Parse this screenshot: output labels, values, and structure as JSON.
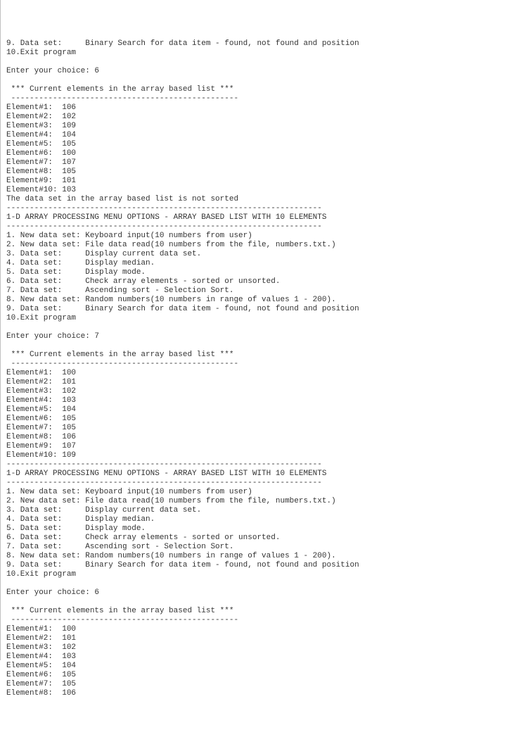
{
  "lines": [
    "9. Data set:     Binary Search for data item - found, not found and position",
    "10.Exit program",
    "",
    "Enter your choice: 6",
    "",
    " *** Current elements in the array based list ***",
    " -------------------------------------------------",
    "Element#1:  106",
    "Element#2:  102",
    "Element#3:  109",
    "Element#4:  104",
    "Element#5:  105",
    "Element#6:  100",
    "Element#7:  107",
    "Element#8:  105",
    "Element#9:  101",
    "Element#10: 103",
    "The data set in the array based list is not sorted",
    "--------------------------------------------------------------------",
    "1-D ARRAY PROCESSING MENU OPTIONS - ARRAY BASED LIST WITH 10 ELEMENTS",
    "--------------------------------------------------------------------",
    "1. New data set: Keyboard input(10 numbers from user)",
    "2. New data set: File data read(10 numbers from the file, numbers.txt.)",
    "3. Data set:     Display current data set.",
    "4. Data set:     Display median.",
    "5. Data set:     Display mode.",
    "6. Data set:     Check array elements - sorted or unsorted.",
    "7. Data set:     Ascending sort - Selection Sort.",
    "8. New data set: Random numbers(10 numbers in range of values 1 - 200).",
    "9. Data set:     Binary Search for data item - found, not found and position",
    "10.Exit program",
    "",
    "Enter your choice: 7",
    "",
    " *** Current elements in the array based list ***",
    " -------------------------------------------------",
    "Element#1:  100",
    "Element#2:  101",
    "Element#3:  102",
    "Element#4:  103",
    "Element#5:  104",
    "Element#6:  105",
    "Element#7:  105",
    "Element#8:  106",
    "Element#9:  107",
    "Element#10: 109",
    "--------------------------------------------------------------------",
    "1-D ARRAY PROCESSING MENU OPTIONS - ARRAY BASED LIST WITH 10 ELEMENTS",
    "--------------------------------------------------------------------",
    "1. New data set: Keyboard input(10 numbers from user)",
    "2. New data set: File data read(10 numbers from the file, numbers.txt.)",
    "3. Data set:     Display current data set.",
    "4. Data set:     Display median.",
    "5. Data set:     Display mode.",
    "6. Data set:     Check array elements - sorted or unsorted.",
    "7. Data set:     Ascending sort - Selection Sort.",
    "8. New data set: Random numbers(10 numbers in range of values 1 - 200).",
    "9. Data set:     Binary Search for data item - found, not found and position",
    "10.Exit program",
    "",
    "Enter your choice: 6",
    "",
    " *** Current elements in the array based list ***",
    " -------------------------------------------------",
    "Element#1:  100",
    "Element#2:  101",
    "Element#3:  102",
    "Element#4:  103",
    "Element#5:  104",
    "Element#6:  105",
    "Element#7:  105",
    "Element#8:  106"
  ]
}
